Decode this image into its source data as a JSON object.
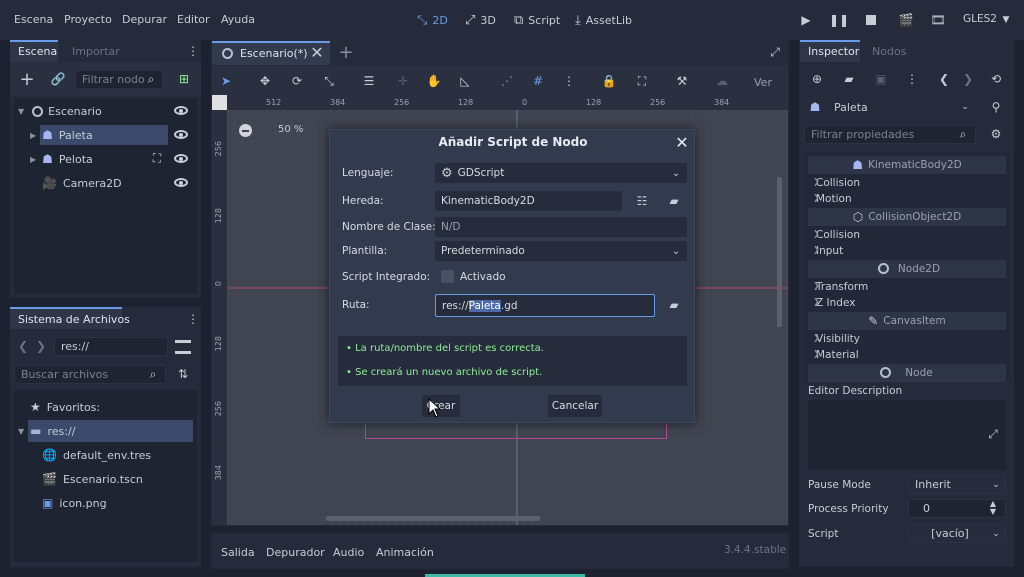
{
  "menu": [
    "Escena",
    "Proyecto",
    "Depurar",
    "Editor",
    "Ayuda"
  ],
  "modes": [
    {
      "icon": "2d-icon",
      "label": "2D",
      "active": true
    },
    {
      "icon": "3d-icon",
      "label": "3D",
      "active": false
    },
    {
      "icon": "script-icon",
      "label": "Script",
      "active": false
    },
    {
      "icon": "assetlib-icon",
      "label": "AssetLib",
      "active": false
    }
  ],
  "renderer": "GLES2",
  "scene_dock": {
    "tabs": [
      "Escena",
      "Importar"
    ],
    "filter_placeholder": "Filtrar nodo",
    "nodes": [
      {
        "name": "Escenario",
        "icon": "node2d-icon"
      },
      {
        "name": "Paleta",
        "icon": "kinematic-body-icon"
      },
      {
        "name": "Pelota",
        "icon": "kinematic-body-icon"
      },
      {
        "name": "Camera2D",
        "icon": "camera-icon"
      }
    ]
  },
  "filesystem": {
    "title": "Sistema de Archivos",
    "path": "res://",
    "search_placeholder": "Buscar archivos",
    "favorites": "Favoritos:",
    "root": "res://",
    "files": [
      "default_env.tres",
      "Escenario.tscn",
      "icon.png"
    ]
  },
  "editor_tab": "Escenario(*)",
  "toolbar_view": "Ver",
  "zoom": "50 %",
  "rulers": {
    "h": [
      "512",
      "384",
      "256",
      "128",
      "0",
      "128",
      "256",
      "384"
    ],
    "v": [
      "256",
      "128",
      "0",
      "128",
      "256",
      "384"
    ]
  },
  "dialog": {
    "title": "Añadir Script de Nodo",
    "language_label": "Lenguaje:",
    "language_value": "GDScript",
    "inherits_label": "Hereda:",
    "inherits_value": "KinematicBody2D",
    "classname_label": "Nombre de Clase:",
    "classname_value": "N/D",
    "template_label": "Plantilla:",
    "template_value": "Predeterminado",
    "builtin_label": "Script Integrado:",
    "builtin_checkbox": "Activado",
    "path_label": "Ruta:",
    "path_prefix": "res://",
    "path_selected": "Paleta",
    "path_suffix": ".gd",
    "msg1": "• La ruta/nombre del script es correcta.",
    "msg2": "• Se creará un nuevo archivo de script.",
    "create": "Crear",
    "cancel": "Cancelar"
  },
  "bottom_tabs": [
    "Salida",
    "Depurador",
    "Audio",
    "Animación"
  ],
  "version": "3.4.4.stable",
  "inspector": {
    "tabs": [
      "Inspector",
      "Nodos"
    ],
    "node": "Paleta",
    "filter_placeholder": "Filtrar propiedades",
    "kinematic": "KinematicBody2D",
    "k_items": [
      "Collision",
      "Motion"
    ],
    "collision_object": "CollisionObject2D",
    "co_items": [
      "Collision",
      "Input"
    ],
    "node2d": "Node2D",
    "n2_items": [
      "Transform",
      "Z Index"
    ],
    "canvas_item": "CanvasItem",
    "ci_items": [
      "Visibility",
      "Material"
    ],
    "node_section": "Node",
    "editor_description": "Editor Description",
    "pause_mode_label": "Pause Mode",
    "pause_mode_value": "Inherit",
    "priority_label": "Process Priority",
    "priority_value": "0",
    "script_label": "Script",
    "script_value": "[vacío]"
  },
  "colors": {
    "accent": "#699ce8",
    "success": "#8eef97",
    "selection": "#3b4a6b"
  }
}
